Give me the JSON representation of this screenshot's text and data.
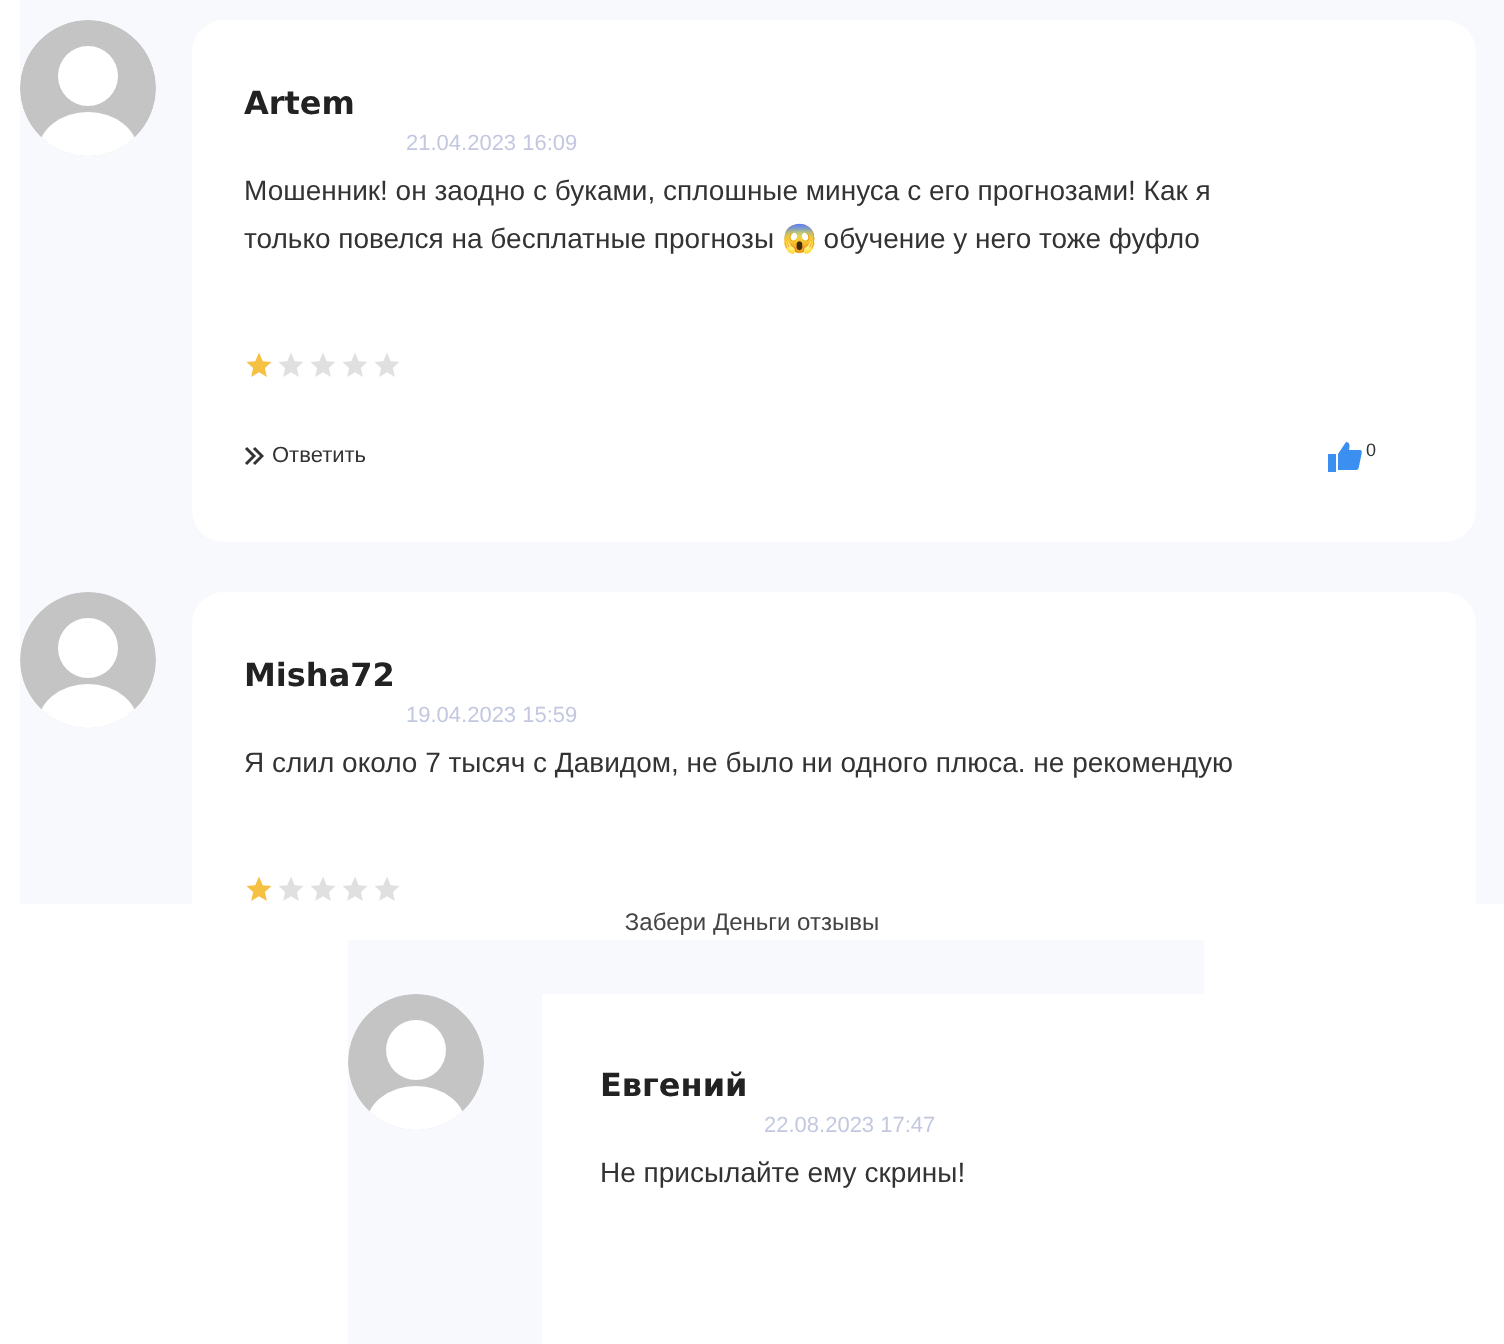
{
  "panels": [
    {
      "reviews": [
        {
          "author": "Artem",
          "date": "21.04.2023 16:09",
          "text": "Мошенник! он заодно с буками, сплошные минуса с его прогнозами! Как я только повелся на бесплатные прогнозы 😱 обучение у него тоже фуфло",
          "stars": 1,
          "reply": "Ответить",
          "likes": "0"
        }
      ]
    },
    {
      "reviews": [
        {
          "author": "Misha72",
          "date": "19.04.2023 15:59",
          "text": "Я слил около 7 тысяч с Давидом, не было ни одного плюса. не рекомендую",
          "stars": 1
        }
      ]
    },
    {
      "caption": "Забери Деньги отзывы",
      "reviews": [
        {
          "author": "Евгений",
          "date": "22.08.2023 17:47",
          "text": "Не присылайте ему скрины!"
        }
      ]
    }
  ]
}
